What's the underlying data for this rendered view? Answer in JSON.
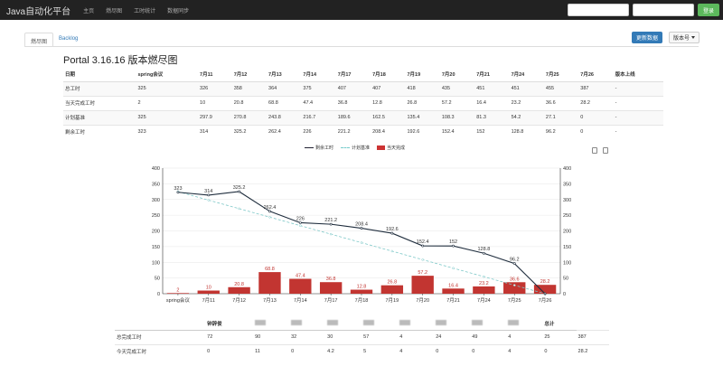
{
  "navbar": {
    "brand": "Java自动化平台",
    "items": [
      "主页",
      "燃尽图",
      "工时统计",
      "数据同步"
    ],
    "login_label": "登录"
  },
  "tabs": [
    {
      "label": "燃尽图",
      "active": true
    },
    {
      "label": "Backlog",
      "active": false
    }
  ],
  "toolbar": {
    "update_label": "更新数据",
    "version_label": "版本号"
  },
  "page_title": "Portal 3.16.16 版本燃尽图",
  "top_table": {
    "headers": [
      "日期",
      "spring会议",
      "7月11",
      "7月12",
      "7月13",
      "7月14",
      "7月17",
      "7月18",
      "7月19",
      "7月20",
      "7月21",
      "7月24",
      "7月25",
      "7月26",
      "版本上线"
    ],
    "rows": [
      [
        "总工时",
        "325",
        "326",
        "358",
        "364",
        "375",
        "407",
        "407",
        "418",
        "435",
        "451",
        "451",
        "455",
        "387",
        "-"
      ],
      [
        "当天完成工时",
        "2",
        "10",
        "20.8",
        "68.8",
        "47.4",
        "36.8",
        "12.8",
        "26.8",
        "57.2",
        "16.4",
        "23.2",
        "36.6",
        "28.2",
        "-"
      ],
      [
        "计划基准",
        "325",
        "297.9",
        "270.8",
        "243.8",
        "216.7",
        "189.6",
        "162.5",
        "135.4",
        "108.3",
        "81.3",
        "54.2",
        "27.1",
        "0",
        "-"
      ],
      [
        "剩余工时",
        "323",
        "314",
        "325.2",
        "262.4",
        "226",
        "221.2",
        "208.4",
        "192.6",
        "152.4",
        "152",
        "128.8",
        "96.2",
        "0",
        "-"
      ]
    ]
  },
  "chart_data": {
    "type": "bar",
    "categories": [
      "spring会议",
      "7月11",
      "7月12",
      "7月13",
      "7月14",
      "7月17",
      "7月18",
      "7月19",
      "7月20",
      "7月21",
      "7月24",
      "7月25",
      "7月26"
    ],
    "legend": [
      "剩余工时",
      "计划基准",
      "当天完成"
    ],
    "series": [
      {
        "name": "剩余工时",
        "type": "line",
        "color": "#1f2d3d",
        "values": [
          323,
          314,
          325.2,
          262.4,
          226,
          221.2,
          208.4,
          192.6,
          152.4,
          152,
          128.8,
          96.2,
          0
        ]
      },
      {
        "name": "计划基准",
        "type": "line-dashed",
        "color": "#7ec8c8",
        "values": [
          325,
          297.9,
          270.8,
          243.8,
          216.7,
          189.6,
          162.5,
          135.4,
          108.3,
          81.3,
          54.2,
          27.1,
          0
        ]
      },
      {
        "name": "当天完成",
        "type": "bar",
        "color": "#c23531",
        "values": [
          2,
          10,
          20.8,
          68.8,
          47.4,
          36.8,
          12.8,
          26.8,
          57.2,
          16.4,
          23.2,
          36.6,
          28.2
        ]
      }
    ],
    "line_labels": [
      "323",
      "314",
      "325.2",
      "262.4",
      "226",
      "221.2",
      "208.4",
      "192.6",
      "152.4",
      "152",
      "128.8",
      "96.2",
      ""
    ],
    "bar_labels": [
      "2",
      "10",
      "20.8",
      "68.8",
      "47.4",
      "36.8",
      "12.8",
      "26.8",
      "57.2",
      "16.4",
      "23.2",
      "36.6",
      "28.2"
    ],
    "ylim": [
      0,
      400
    ],
    "yticks": [
      "0",
      "50",
      "100",
      "150",
      "200",
      "250",
      "300",
      "350",
      "400"
    ],
    "grid": true,
    "legend_position": "top-center"
  },
  "bottom_table": {
    "headers": [
      "",
      "钟辞俊",
      "",
      "",
      "",
      "",
      "",
      "",
      "",
      "",
      "总计"
    ],
    "rows": [
      [
        "总完成工时",
        "72",
        "90",
        "32",
        "30",
        "57",
        "4",
        "24",
        "49",
        "4",
        "25",
        "387"
      ],
      [
        "今天完成工时",
        "0",
        "11",
        "0",
        "4.2",
        "5",
        "4",
        "0",
        "0",
        "4",
        "0",
        "28.2"
      ]
    ]
  }
}
